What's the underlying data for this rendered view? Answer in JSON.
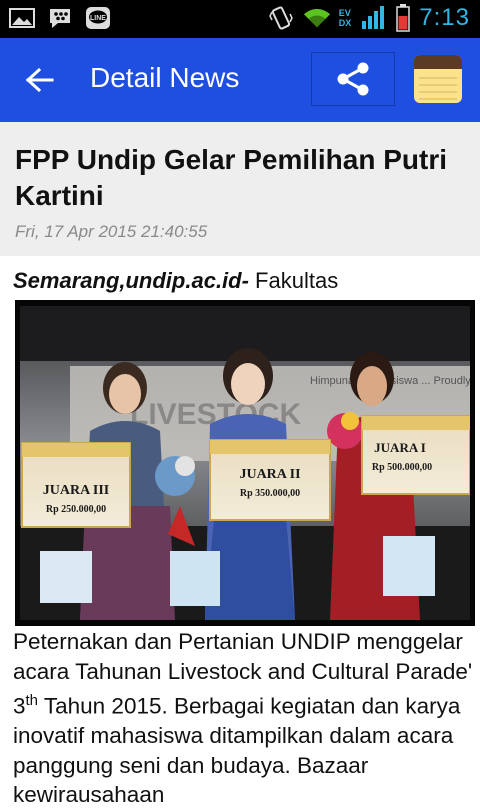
{
  "status_bar": {
    "time": "7:13",
    "network_top": "EV",
    "network_bottom": "DX",
    "icons": [
      "picture-icon",
      "bbm-icon",
      "line-app-icon",
      "vibrate-icon",
      "wifi-icon",
      "signal-icon",
      "battery-icon"
    ]
  },
  "app_bar": {
    "title": "Detail News",
    "color": "#1e4fe0"
  },
  "article": {
    "title": "FPP Undip Gelar Pemilihan Putri Kartini",
    "date": "Fri, 17 Apr 2015 21:40:55",
    "lead_source": "Semarang,undip.ac.id-",
    "lead_text": " Fakultas",
    "body_part1": "Peternakan dan Pertanian UNDIP menggelar acara Tahunan Livestock and Cultural Parade' 3",
    "body_sup": "th",
    "body_part2": " Tahun 2015. Berbagai kegiatan dan karya inovatif mahasiswa ditampilkan dalam acara panggung seni dan budaya. Bazaar kewirausahaan",
    "photo": {
      "banner": "LIVESTOCK AND CULTURE PARADE 2015",
      "sign_1": {
        "title": "JUARA III",
        "prize": "Rp 250.000,00"
      },
      "sign_2": {
        "title": "JUARA II",
        "prize": "Rp 350.000,00"
      },
      "sign_3": {
        "title": "JUARA I",
        "prize": "Rp 500.000,00"
      },
      "backdrop_text": "Himpunan Mahasiswa ... Proudly Pre..."
    }
  }
}
